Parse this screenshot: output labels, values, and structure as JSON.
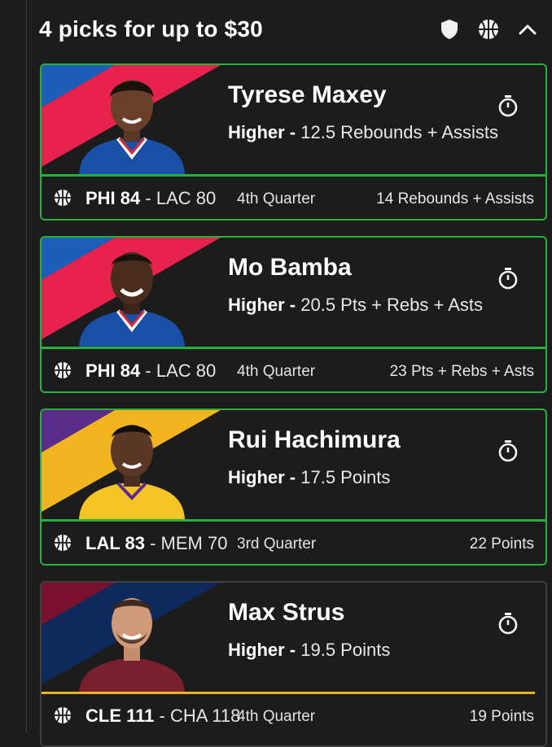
{
  "header": {
    "title": "4 picks for up to $30"
  },
  "picks": [
    {
      "player": "Tyrese Maxey",
      "direction": "Higher",
      "line": "12.5 Rebounds + Assists",
      "team_a": "PHI 84",
      "team_b": "LAC 80",
      "period": "4th Quarter",
      "current": "14 Rebounds + Assists",
      "stripe_colors": [
        "#1d5fb8",
        "#e6224d"
      ],
      "jersey": "#1a4fa8",
      "status": "green"
    },
    {
      "player": "Mo Bamba",
      "direction": "Higher",
      "line": "20.5 Pts + Rebs + Asts",
      "team_a": "PHI 84",
      "team_b": "LAC 80",
      "period": "4th Quarter",
      "current": "23 Pts + Rebs + Asts",
      "stripe_colors": [
        "#1d5fb8",
        "#e6224d"
      ],
      "jersey": "#1a4fa8",
      "status": "green"
    },
    {
      "player": "Rui Hachimura",
      "direction": "Higher",
      "line": "17.5 Points",
      "team_a": "LAL 83",
      "team_b": "MEM 70",
      "period": "3rd Quarter",
      "current": "22 Points",
      "stripe_colors": [
        "#5a2d8c",
        "#f2b51f"
      ],
      "jersey": "#f5c526",
      "status": "green"
    },
    {
      "player": "Max Strus",
      "direction": "Higher",
      "line": "19.5 Points",
      "team_a": "CLE 111",
      "team_b": "CHA 118",
      "period": "4th Quarter",
      "current": "19 Points",
      "stripe_colors": [
        "#7a1030",
        "#0e2a5c"
      ],
      "jersey": "#7a1f2e",
      "status": "pending"
    }
  ],
  "separator": " - ",
  "colors": {
    "win": "#27b03b",
    "pending": "#e6b325",
    "bg": "#1c1c1c"
  },
  "icons": [
    "shield-icon",
    "basketball-icon",
    "chevron-up-icon",
    "stopwatch-icon"
  ]
}
